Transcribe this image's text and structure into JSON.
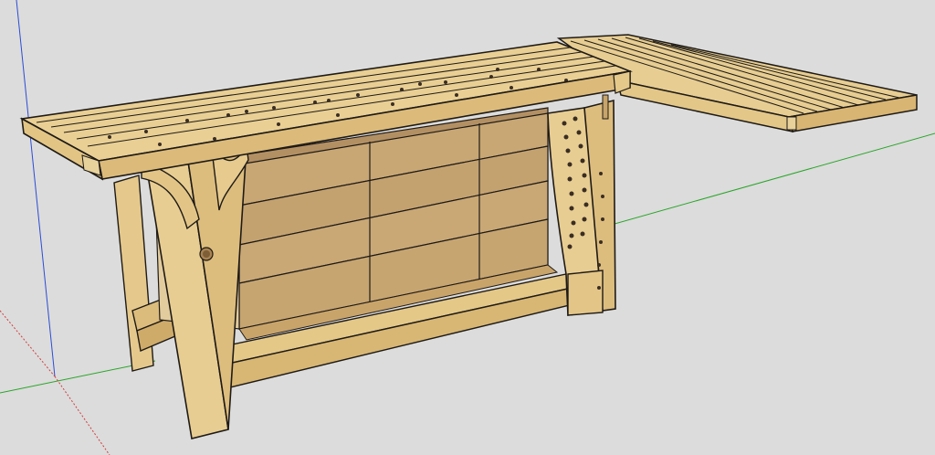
{
  "app": {
    "name": "",
    "view": "3D perspective"
  },
  "scene": {
    "model": "workbench-with-drawers-and-extension",
    "axes": {
      "red": "#d33b3b",
      "green": "#2aa52a",
      "blue": "#2b4cd3"
    },
    "colors": {
      "background": "#dcdcdc",
      "wood_light": "#e9cf94",
      "wood_mid": "#ddbb78",
      "wood_dark": "#c99f5f",
      "drawer": "#c8a774",
      "drawer_dark": "#b28f5e",
      "outline": "#1e1a16",
      "hole": "#3a2d22"
    }
  }
}
